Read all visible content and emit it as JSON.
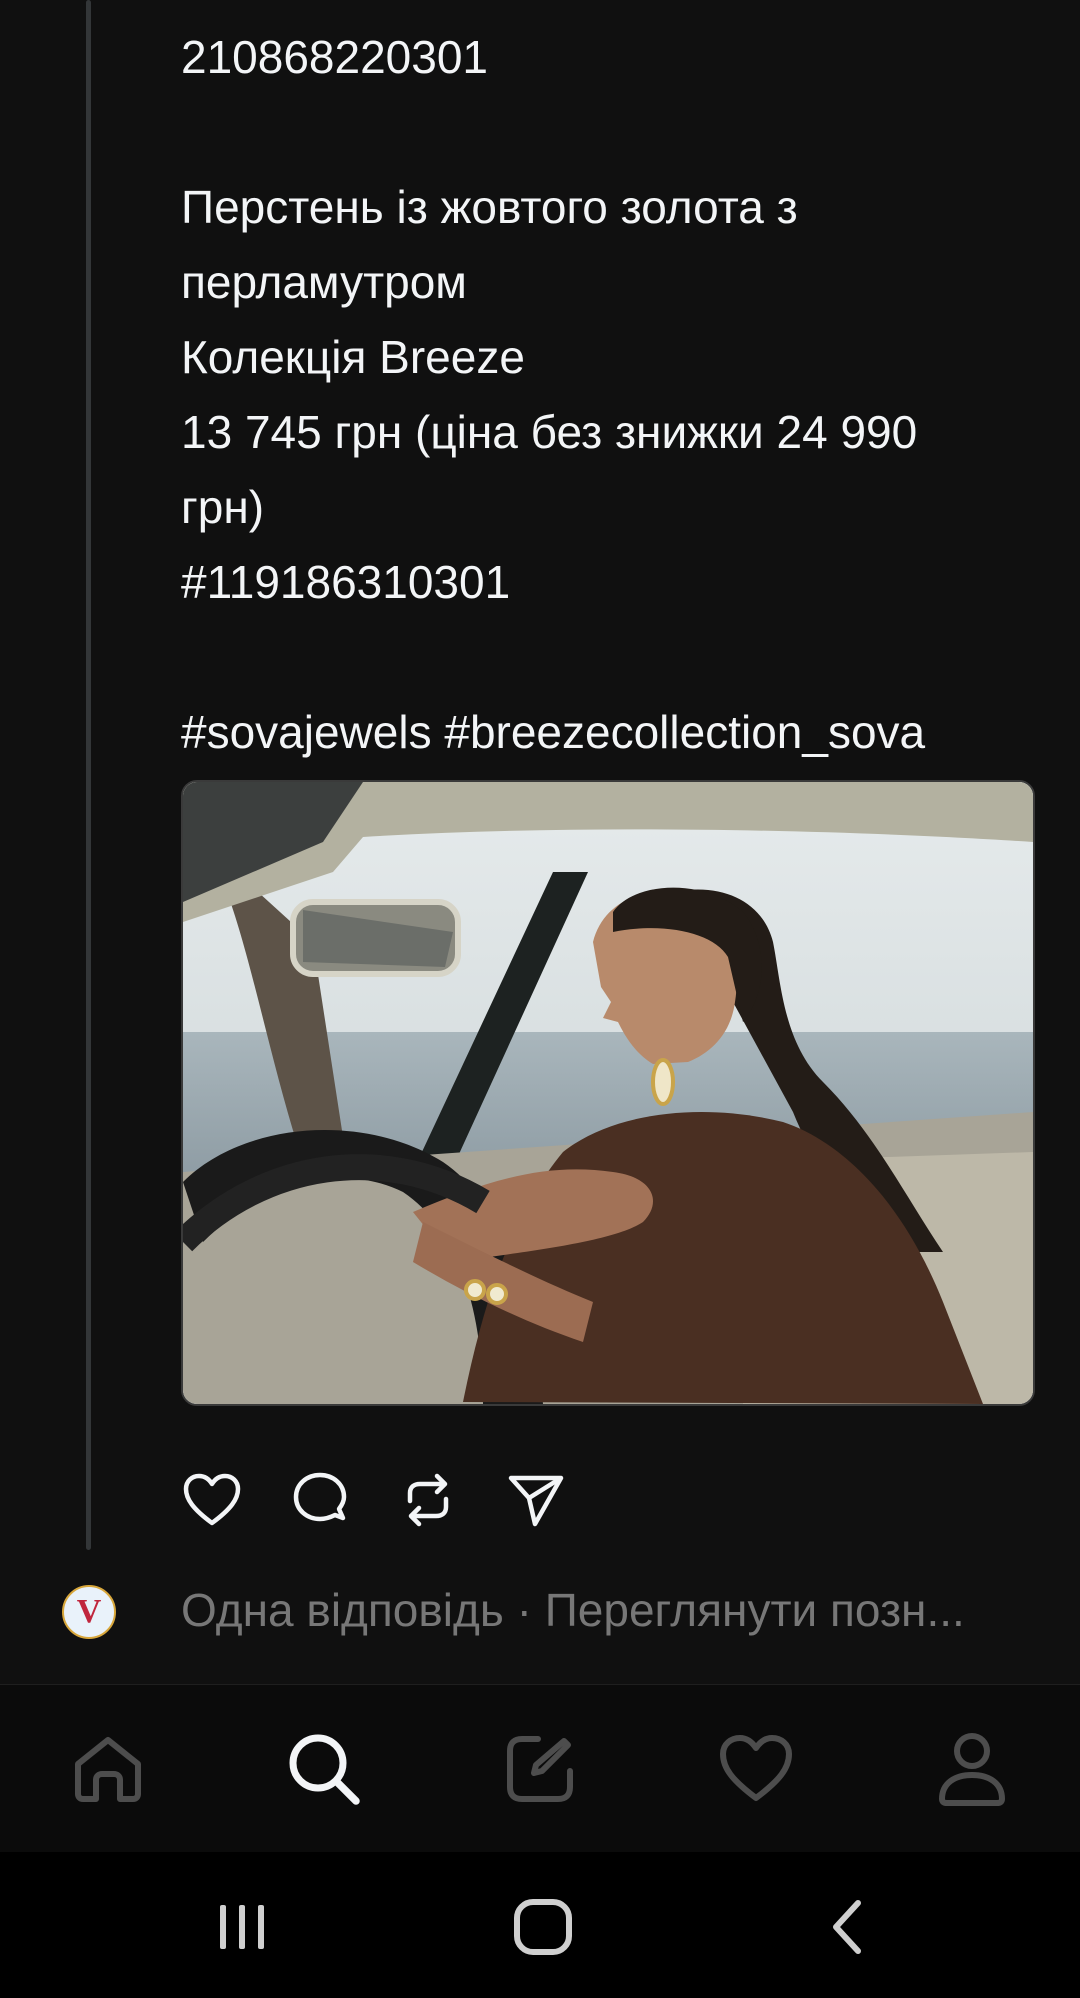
{
  "post": {
    "lines": [
      "210868220301",
      "",
      "Перстень із жовтого золота з",
      "перламутром",
      "Колекція Breeze",
      "13 745 грн (ціна без знижки 24 990",
      "грн)",
      "#119186310301",
      "",
      "#sovajewels #breezecollection_sova"
    ]
  },
  "actions": {
    "like_icon": "heart-icon",
    "comment_icon": "comment-icon",
    "repost_icon": "repost-icon",
    "share_icon": "send-icon"
  },
  "reply": {
    "avatar_letter": "V",
    "text": "Одна відповідь · Переглянути позн..."
  },
  "tabbar": {
    "items": [
      "home-icon",
      "search-icon",
      "compose-icon",
      "activity-heart-icon",
      "profile-icon"
    ],
    "active": "search-icon"
  },
  "colors": {
    "background": "#101010",
    "text": "#f3f5f7",
    "muted": "#777777",
    "inactive_icon": "#4d4d4d",
    "active_icon": "#f3f5f7"
  }
}
